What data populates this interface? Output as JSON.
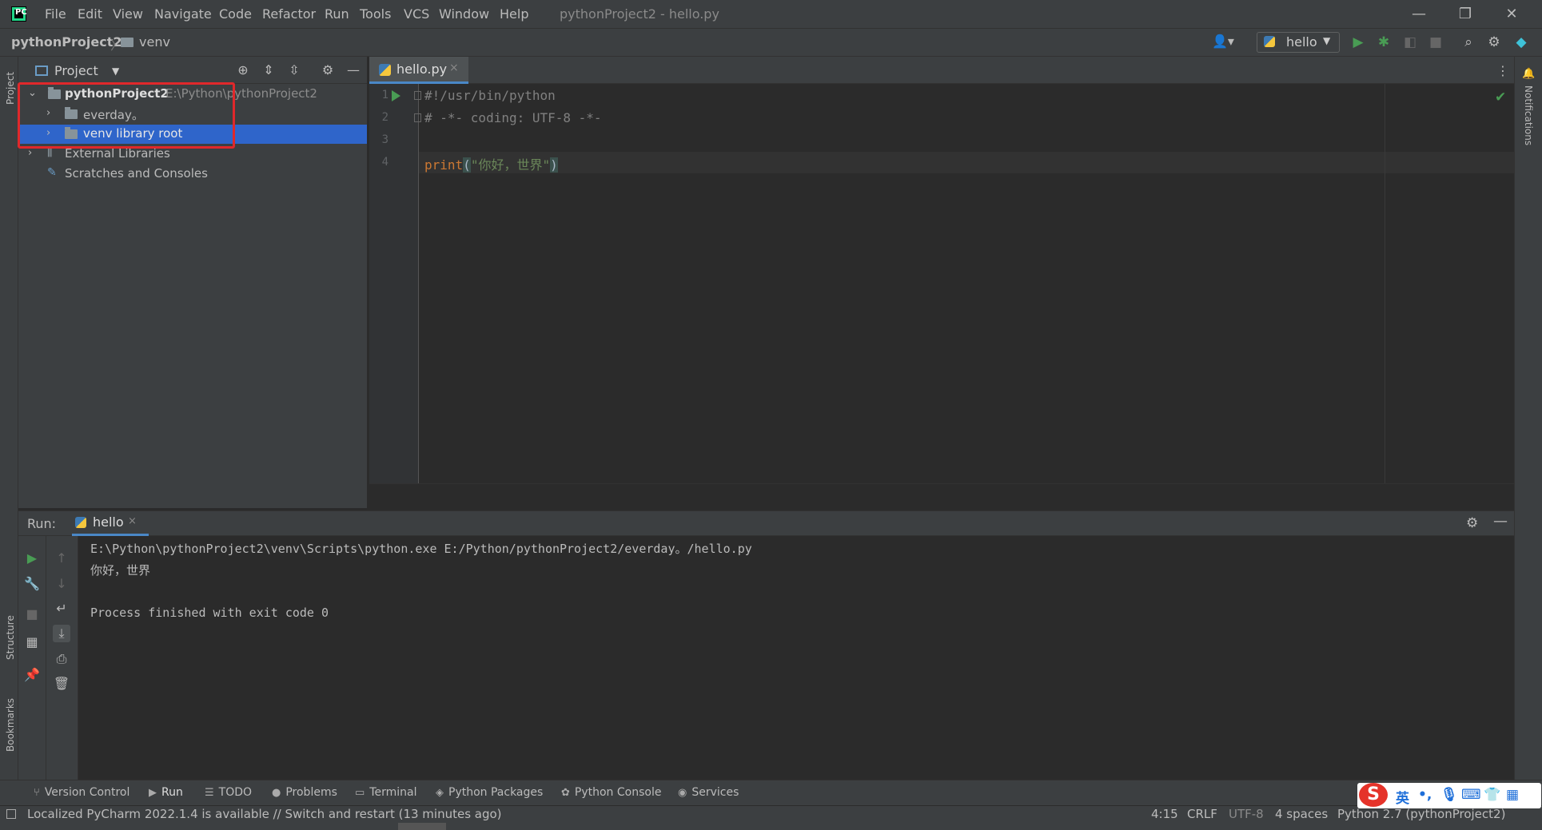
{
  "menu": {
    "items": [
      "File",
      "Edit",
      "View",
      "Navigate",
      "Code",
      "Refactor",
      "Run",
      "Tools",
      "VCS",
      "Window",
      "Help"
    ],
    "window_title": "pythonProject2 - hello.py"
  },
  "window_controls": {
    "minimize": "—",
    "restore": "❐",
    "close": "✕"
  },
  "breadcrumb": {
    "project": "pythonProject2",
    "separator": "〉",
    "folder": "venv"
  },
  "toolbar": {
    "run_config": "hello",
    "user_icon": "👤▾"
  },
  "left_strip": {
    "project": "Project",
    "structure": "Structure",
    "bookmarks": "Bookmarks"
  },
  "right_strip": {
    "notifications": "Notifications"
  },
  "project_panel": {
    "title": "Project",
    "tree": [
      {
        "label": "pythonProject2",
        "sub": "E:\\Python\\pythonProject2",
        "expanded": true
      },
      {
        "label": "everday。",
        "expanded": false
      },
      {
        "label": "venv  library root",
        "expanded": false,
        "selected": true
      },
      {
        "label": "External Libraries",
        "expanded": false
      },
      {
        "label": "Scratches and Consoles"
      }
    ]
  },
  "editor": {
    "tab": "hello.py",
    "line_numbers": [
      "1",
      "2",
      "3",
      "4"
    ],
    "lines": {
      "l1": "#!/usr/bin/python",
      "l2": "# -*- coding: UTF-8 -*-",
      "l4_fn": "print",
      "l4_open": "(",
      "l4_str": "\"你好，世界\"",
      "l4_close": ")"
    }
  },
  "run_panel": {
    "label": "Run:",
    "tab": "hello",
    "console": [
      "E:\\Python\\pythonProject2\\venv\\Scripts\\python.exe E:/Python/pythonProject2/everday。/hello.py",
      "你好，世界",
      "",
      "Process finished with exit code 0"
    ]
  },
  "bottom_tools": [
    "Version Control",
    "Run",
    "TODO",
    "Problems",
    "Terminal",
    "Python Packages",
    "Python Console",
    "Services"
  ],
  "status": {
    "message": "Localized PyCharm 2022.1.4 is available // Switch and restart (13 minutes ago)",
    "position": "4:15",
    "line_sep": "CRLF",
    "encoding": "UTF-8",
    "indent": "4 spaces",
    "interpreter": "Python 2.7 (pythonProject2)"
  },
  "ime": {
    "logo": "S",
    "mode": "英"
  },
  "colors": {
    "accent": "#2f65ca",
    "run_green": "#499c54",
    "highlight_red": "#e0282b",
    "keyword": "#cc7832",
    "string": "#6a8759",
    "comment": "#808080"
  }
}
